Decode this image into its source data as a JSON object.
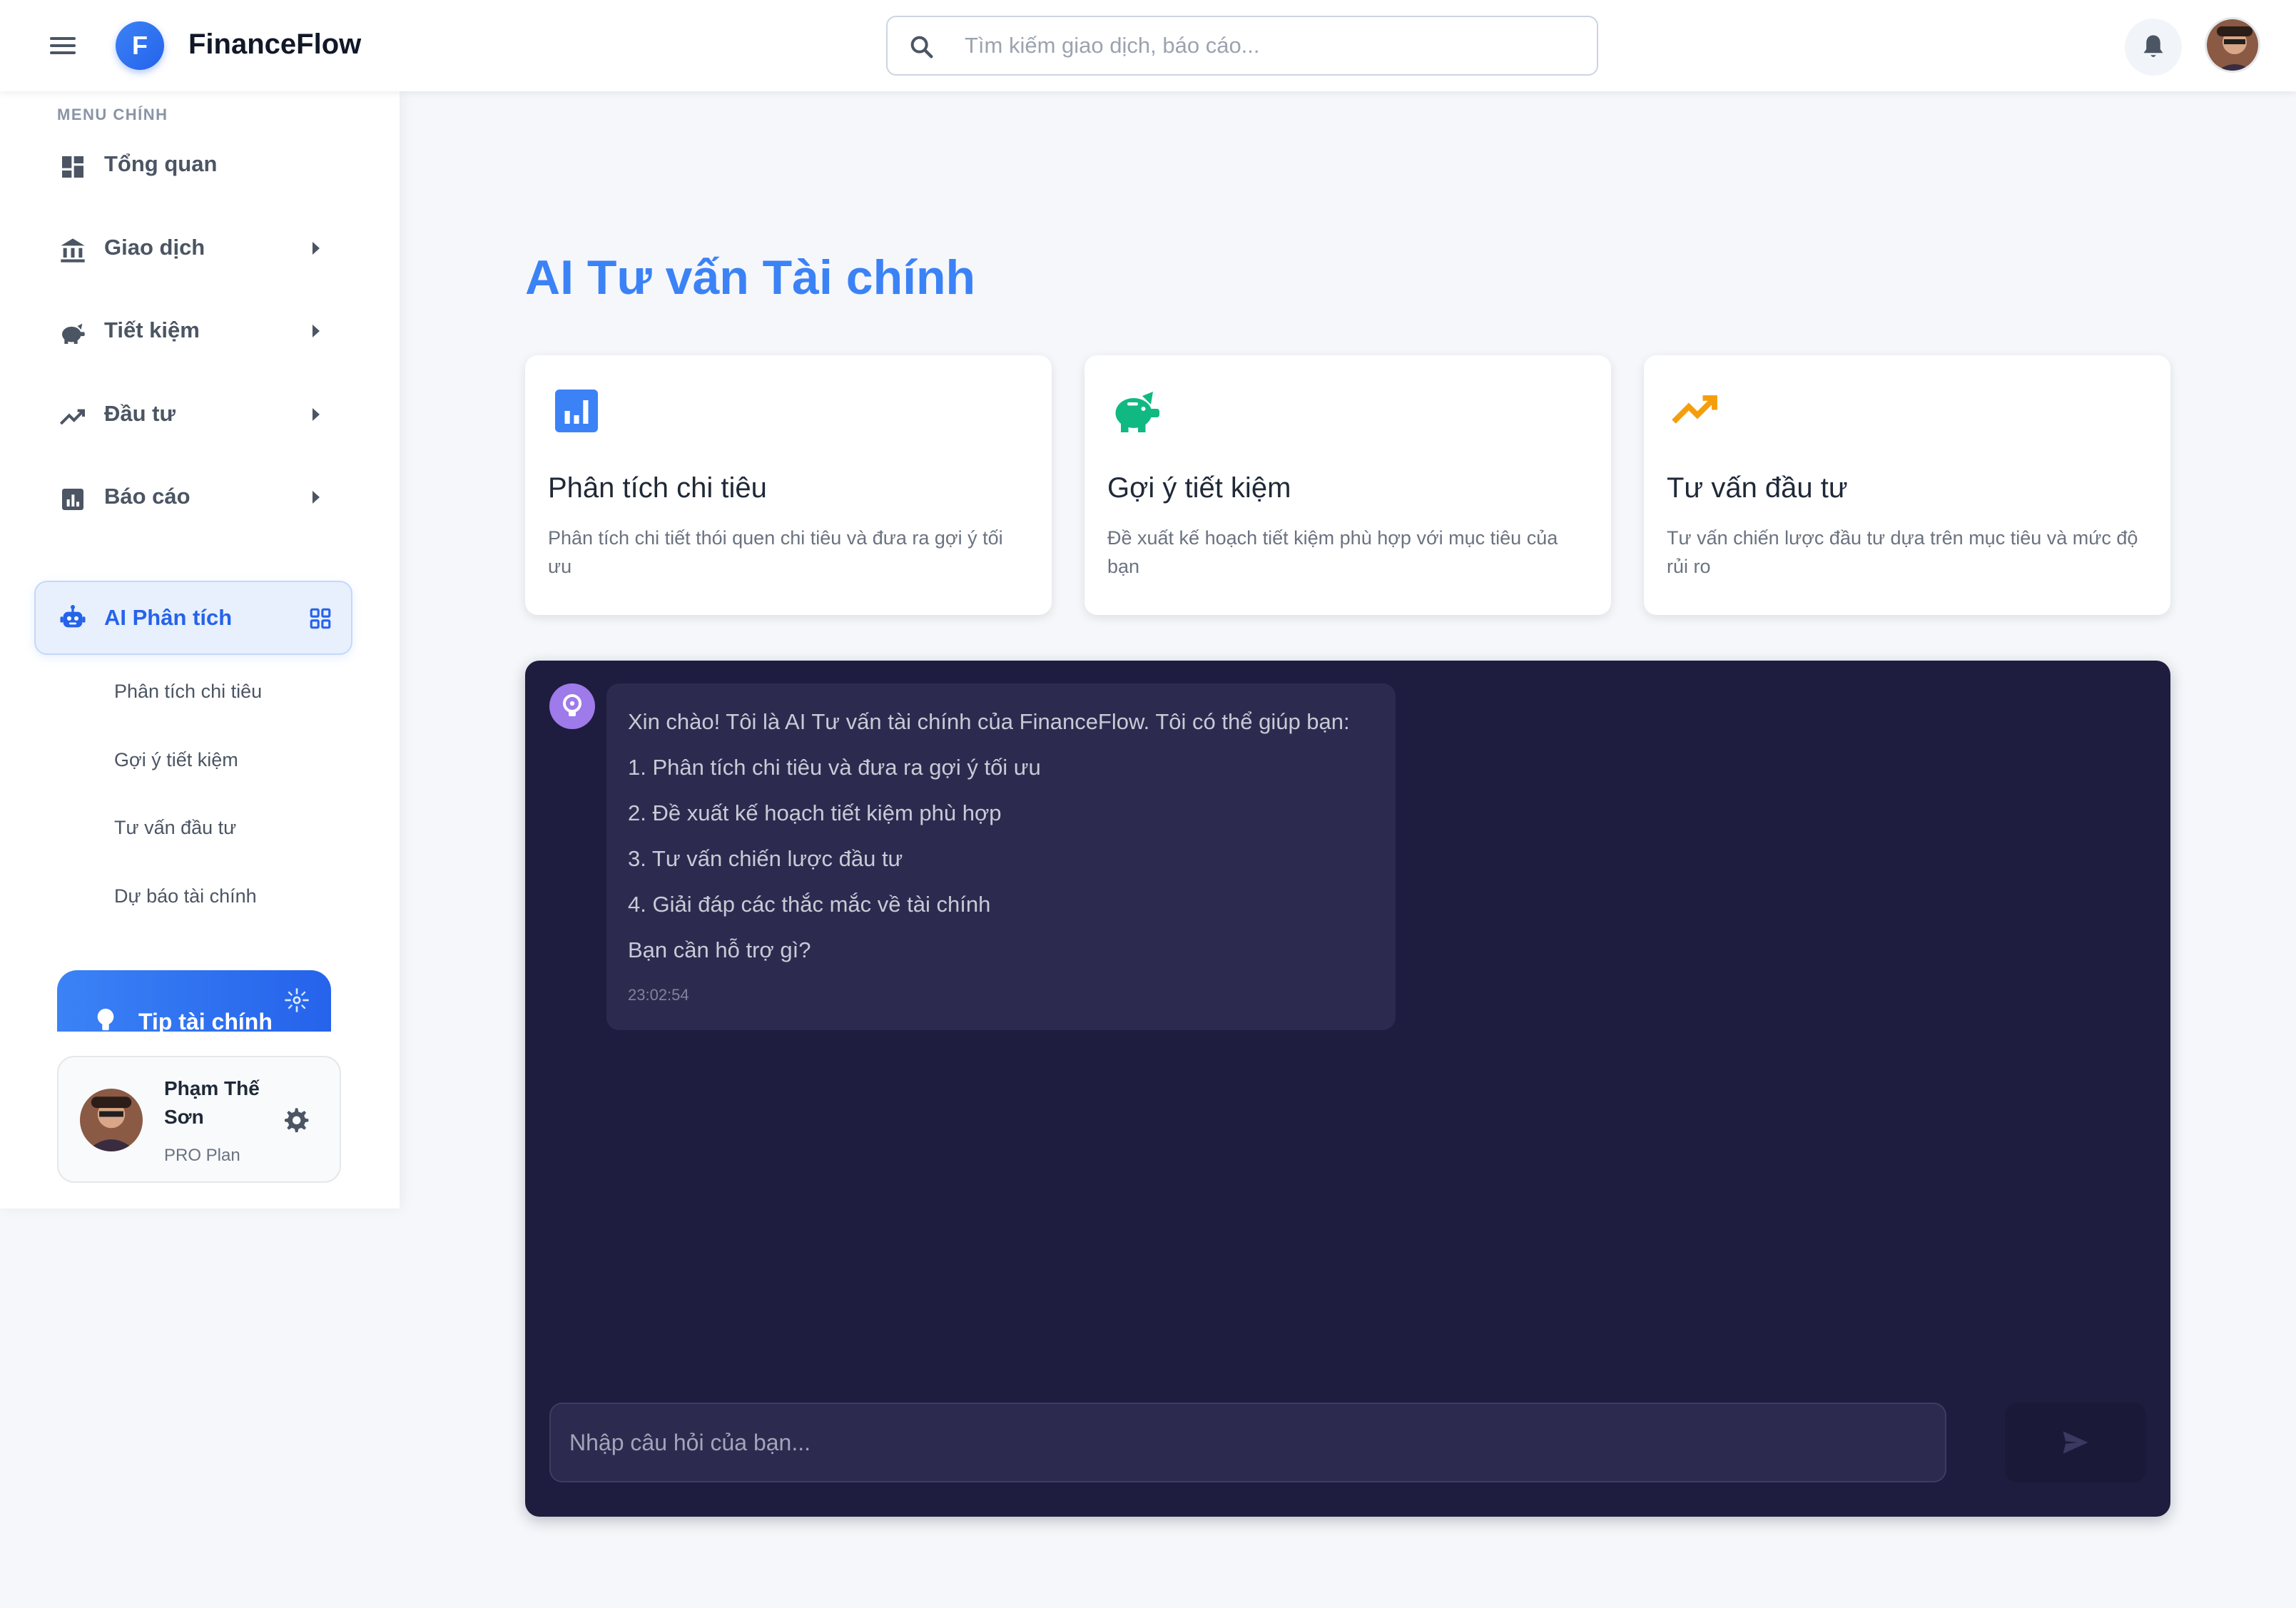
{
  "header": {
    "logo_letter": "F",
    "app_name": "FinanceFlow",
    "search_placeholder": "Tìm kiếm giao dịch, báo cáo..."
  },
  "sidebar": {
    "menu_title": "MENU CHÍNH",
    "items": [
      {
        "label": "Tổng quan",
        "icon": "dashboard-icon"
      },
      {
        "label": "Giao dịch",
        "icon": "bank-icon"
      },
      {
        "label": "Tiết kiệm",
        "icon": "piggy-bank-icon"
      },
      {
        "label": "Đầu tư",
        "icon": "trending-up-icon"
      },
      {
        "label": "Báo cáo",
        "icon": "bar-chart-icon"
      },
      {
        "label": "AI Phân tích",
        "icon": "robot-icon"
      }
    ],
    "sub_items": [
      "Phân tích chi tiêu",
      "Gợi ý tiết kiệm",
      "Tư vấn đầu tư",
      "Dự báo tài chính"
    ],
    "tip_label": "Tip tài chính",
    "user": {
      "name": "Phạm Thế Sơn",
      "plan": "PRO Plan"
    }
  },
  "main": {
    "title": "AI Tư vấn Tài chính",
    "cards": [
      {
        "title": "Phân tích chi tiêu",
        "desc": "Phân tích chi tiết thói quen chi tiêu và đưa ra gợi ý tối ưu",
        "icon": "analytics-icon",
        "color": "#3b82f6"
      },
      {
        "title": "Gợi ý tiết kiệm",
        "desc": "Đề xuất kế hoạch tiết kiệm phù hợp với mục tiêu của bạn",
        "icon": "piggy-bank-icon",
        "color": "#10b981"
      },
      {
        "title": "Tư vấn đầu tư",
        "desc": "Tư vấn chiến lược đầu tư dựa trên mục tiêu và mức độ rủi ro",
        "icon": "trending-up-icon",
        "color": "#f59e0b"
      }
    ],
    "chat": {
      "messages": [
        {
          "lines": [
            "Xin chào! Tôi là AI Tư vấn tài chính của FinanceFlow. Tôi có thể giúp bạn:",
            "1. Phân tích chi tiêu và đưa ra gợi ý tối ưu",
            "2. Đề xuất kế hoạch tiết kiệm phù hợp",
            "3. Tư vấn chiến lược đầu tư",
            "4. Giải đáp các thắc mắc về tài chính",
            "Bạn cần hỗ trợ gì?"
          ],
          "time": "23:02:54"
        }
      ],
      "input_placeholder": "Nhập câu hỏi của bạn..."
    }
  },
  "colors": {
    "accent": "#3b82f6",
    "chat_bg": "#1e1d3f",
    "bubble_bg": "#2c2b4f"
  }
}
